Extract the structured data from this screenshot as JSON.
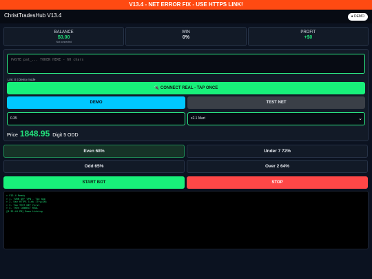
{
  "banner": {
    "text": "V13.4 - NET ERROR FIX - USE HTTPS LINK!"
  },
  "header": {
    "title": "ChristTradesHub V13.4",
    "mode_pill": "● DEMO"
  },
  "stats": [
    {
      "label": "BALANCE",
      "value": "$0.00",
      "sub": "Not connected"
    },
    {
      "label": "WIN",
      "value": "0%"
    },
    {
      "label": "PROFIT",
      "value": "+$0"
    }
  ],
  "token": {
    "placeholder": "PASTE pat_... TOKEN HERE - 60 chars"
  },
  "login_note": "Lim: 0 | Demo mode",
  "buttons": {
    "connect": "🔌 CONNECT REAL - TAP ONCE",
    "demo": "DEMO",
    "test_net": "TEST NET",
    "start": "START BOT",
    "stop": "STOP"
  },
  "stake": {
    "value": "0.35"
  },
  "martingale": {
    "selected": "x2.1 Mart"
  },
  "price": {
    "label": "Price",
    "value": "1848.95",
    "digit_text": "Digit 5 ODD"
  },
  "picks": [
    {
      "label": "Even 68%",
      "active": true
    },
    {
      "label": "Under 7 72%",
      "active": false
    },
    {
      "label": "Odd 65%",
      "active": false
    },
    {
      "label": "Over 2 64%",
      "active": false
    }
  ],
  "log": [
    "> V13.4 Ready",
    "> 1. TURN OFF VPN - Tip app",
    "> 2. Use HTTPS link (Try+GH)",
    "> 3. Tap TEST NET first",
    "> 4. Then CONNECT REAL",
    "[8:32:44 PM] Demo ticking"
  ],
  "colors": {
    "accent_green": "#18f07a",
    "accent_cyan": "#00c8ff",
    "danger_red": "#ff4747",
    "banner_orange": "#ff4a12"
  }
}
